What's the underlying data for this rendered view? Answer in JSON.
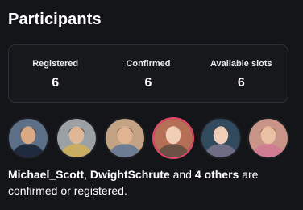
{
  "header": {
    "title": "Participants"
  },
  "stats": [
    {
      "label": "Registered",
      "value": "6"
    },
    {
      "label": "Confirmed",
      "value": "6"
    },
    {
      "label": "Available slots",
      "value": "6"
    }
  ],
  "avatars": [
    {
      "name": "michael-scott-avatar",
      "bg": "#5b6f86",
      "skin": "#d9a985",
      "hair": "#3a2a20",
      "shirt": "#1f2a3e"
    },
    {
      "name": "dwight-schrute-avatar",
      "bg": "#9aa0a4",
      "skin": "#e0b898",
      "hair": "#4a3524",
      "shirt": "#c9ad62"
    },
    {
      "name": "jim-halpert-avatar",
      "bg": "#c4a384",
      "skin": "#e0b493",
      "hair": "#5b4030",
      "shirt": "#6d7c92"
    },
    {
      "name": "participant-4-avatar",
      "bg": "#b66f57",
      "skin": "#f1cfb7",
      "hair": "#d0a878",
      "shirt": "#6b5244"
    },
    {
      "name": "participant-5-avatar",
      "bg": "#314a5e",
      "skin": "#f0cdb6",
      "hair": "#4b3222",
      "shirt": "#6f6d84"
    },
    {
      "name": "pam-beesly-avatar",
      "bg": "#c89488",
      "skin": "#eac0a4",
      "hair": "#8a4e33",
      "shirt": "#d07d93"
    }
  ],
  "summary": {
    "name1": "Michael_Scott",
    "sep": ", ",
    "name2": "DwightSchrute",
    "and": " and ",
    "others": "4 others",
    "tail": " are confirmed or registered."
  },
  "colors": {
    "background": "#141519",
    "card_border": "#2f3138",
    "highlight_ring": "#e8476b"
  }
}
